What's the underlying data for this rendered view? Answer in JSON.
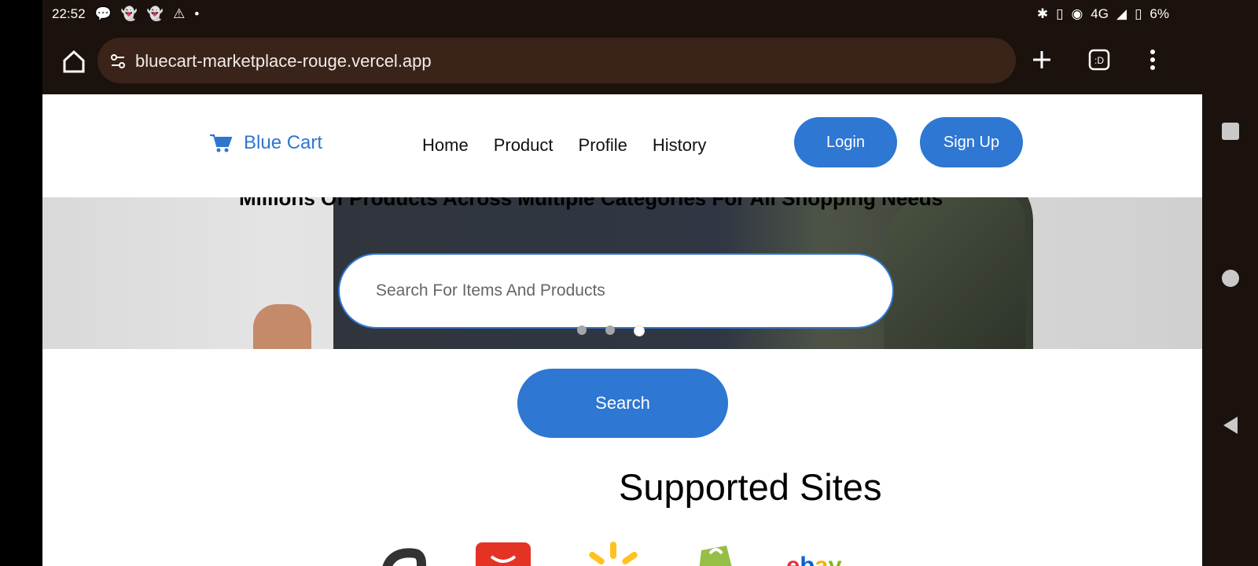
{
  "status": {
    "time": "22:52",
    "network": "4G",
    "battery": "6%"
  },
  "browser": {
    "url": "bluecart-marketplace-rouge.vercel.app",
    "home_icon": "home-icon",
    "new_tab_icon": "plus-icon",
    "tab_icon": ":D",
    "menu_icon": "more-vertical-icon"
  },
  "site": {
    "brand": "Blue Cart",
    "nav": [
      "Home",
      "Product",
      "Profile",
      "History"
    ],
    "login_label": "Login",
    "signup_label": "Sign Up",
    "hero_tagline": "Millions Of Products Across Multiple Categories For All Shopping Needs",
    "search_placeholder": "Search For Items And Products",
    "search_label": "Search",
    "supported_title": "Supported Sites",
    "carousel_active_index": 3,
    "carousel_count": 3
  }
}
